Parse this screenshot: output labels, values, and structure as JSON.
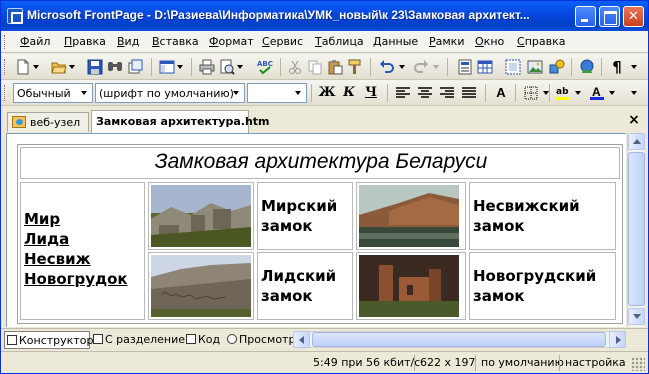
{
  "window": {
    "title": "Microsoft FrontPage - D:\\Разиева\\Информатика\\УМК_новый\\к 23\\Замковая архитект...",
    "minimize": "_",
    "maximize": "□",
    "close": "✕"
  },
  "menu": {
    "items": [
      {
        "u": "Ф",
        "rest": "айл"
      },
      {
        "u": "П",
        "rest": "равка"
      },
      {
        "u": "В",
        "rest": "ид"
      },
      {
        "u": "В",
        "rest": "ставка"
      },
      {
        "u": "Ф",
        "rest": "ормат"
      },
      {
        "u": "С",
        "rest": "ервис"
      },
      {
        "u": "Т",
        "rest": "аблица"
      },
      {
        "u": "Д",
        "rest": "анные"
      },
      {
        "u": "Р",
        "rest": "амки"
      },
      {
        "u": "О",
        "rest": "кно"
      },
      {
        "u": "С",
        "rest": "правка"
      }
    ]
  },
  "toolbar_standard": {
    "icons": [
      "new-page-icon",
      "open-icon",
      "save-icon",
      "search-icon",
      "publish-icon",
      "toggle-pane-icon",
      "print-icon",
      "preview-icon",
      "spelling-icon",
      "cut-icon",
      "copy-icon",
      "paste-icon",
      "format-painter-icon",
      "undo-icon",
      "redo-icon",
      "web-component-icon",
      "insert-table-icon",
      "insert-layer-icon",
      "insert-picture-icon",
      "drawing-icon",
      "hyperlink-icon",
      "show-all-icon"
    ],
    "show_all_glyph": "¶"
  },
  "toolbar_format": {
    "style": "Обычный",
    "font": "(шрифт по умолчанию)",
    "size": "",
    "bold": "Ж",
    "italic": "К",
    "underline": "Ч",
    "increase_font": "A"
  },
  "tabs": {
    "web": "веб-узел",
    "page": "Замковая архитектура.htm",
    "close": "×"
  },
  "page": {
    "heading": "Замковая архитектура Беларуси",
    "links": [
      "Мир",
      "Лида",
      "Несвиж",
      "Новогрудок"
    ],
    "captions": {
      "mir": [
        "Мирский",
        "замок"
      ],
      "nesvizh": [
        "Несвижский",
        "замок"
      ],
      "lida": [
        "Лидский",
        "замок"
      ],
      "novogrudok": [
        "Новогрудский",
        "замок"
      ]
    }
  },
  "view_tabs": {
    "design": "Конструктор",
    "split": "С разделением",
    "code": "Код",
    "preview": "Просмотр"
  },
  "status": {
    "download_time": "5:49 при 56 кбит/с",
    "page_size": "622 x 197",
    "schema": "по умолчанию",
    "css": "настройка"
  },
  "colors": {
    "titlebar": "#0548dd",
    "accent": "#316ac5"
  }
}
